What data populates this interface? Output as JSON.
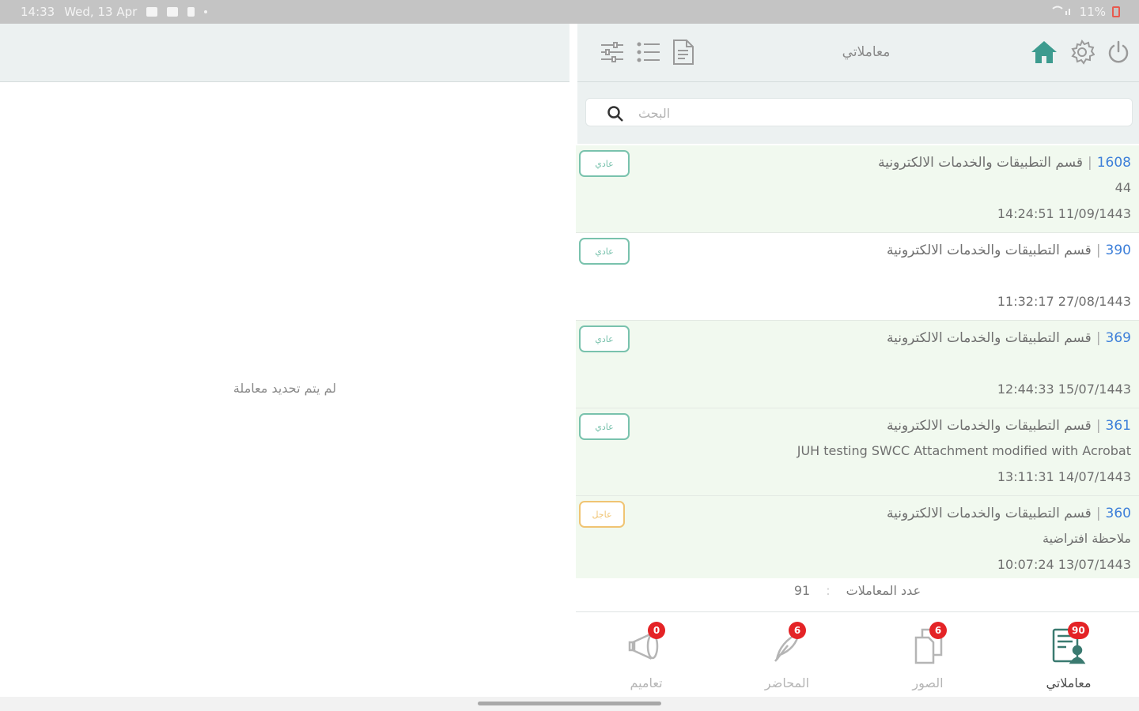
{
  "statusbar": {
    "time": "14:33",
    "date": "Wed, 13 Apr",
    "battery": "11%"
  },
  "header": {
    "title": "معاملاتي"
  },
  "search": {
    "placeholder": "البحث"
  },
  "empty_state": {
    "message": "لم يتم تحديد معاملة"
  },
  "transactions": [
    {
      "number": "1608",
      "department": "قسم التطبيقات والخدمات الالكترونية",
      "subject": "44",
      "datetime": "14:24:51  11/09/1443",
      "priority": "عادي",
      "priority_color": "#79c2ad"
    },
    {
      "number": "390",
      "department": "قسم التطبيقات والخدمات الالكترونية",
      "subject": "",
      "datetime": "11:32:17  27/08/1443",
      "priority": "عادي",
      "priority_color": "#79c2ad"
    },
    {
      "number": "369",
      "department": "قسم التطبيقات والخدمات الالكترونية",
      "subject": "",
      "datetime": "12:44:33  15/07/1443",
      "priority": "عادي",
      "priority_color": "#79c2ad"
    },
    {
      "number": "361",
      "department": "قسم التطبيقات والخدمات الالكترونية",
      "subject": "JUH testing SWCC Attachment modified with Acrobat",
      "datetime": "13:11:31  14/07/1443",
      "priority": "عادي",
      "priority_color": "#79c2ad"
    },
    {
      "number": "360",
      "department": "قسم التطبيقات والخدمات الالكترونية",
      "subject": "ملاحظة افتراضية",
      "datetime": "10:07:24  13/07/1443",
      "priority": "عاجل",
      "priority_color": "#f0c473"
    }
  ],
  "count": {
    "label": "عدد المعاملات",
    "value": "91"
  },
  "tabs": [
    {
      "label": "تعاميم",
      "badge": "0",
      "icon": "megaphone-icon"
    },
    {
      "label": "المحاضر",
      "badge": "6",
      "icon": "quill-icon"
    },
    {
      "label": "الصور",
      "badge": "6",
      "icon": "copy-documents-icon"
    },
    {
      "label": "معاملاتي",
      "badge": "90",
      "icon": "transactions-icon"
    }
  ],
  "colors": {
    "accent": "#3d9b8f",
    "badge": "#e42326",
    "link_number": "#3d7fd9",
    "row_bg": "#f1f9ef"
  }
}
